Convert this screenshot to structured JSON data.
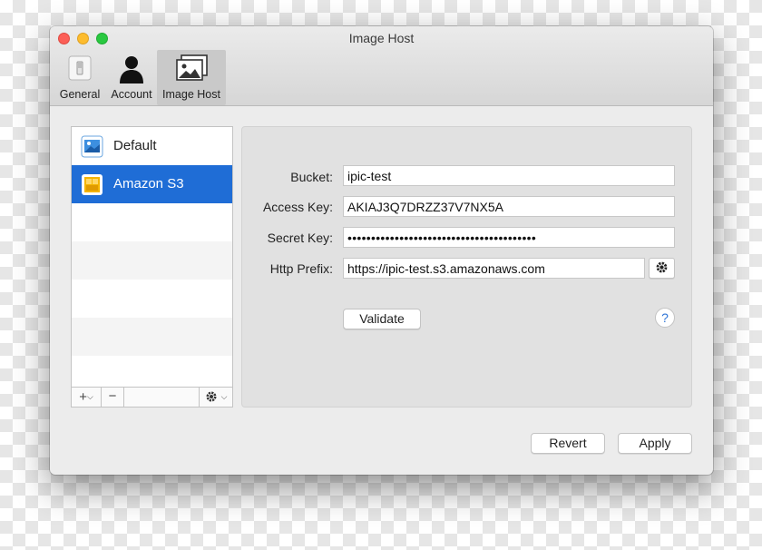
{
  "window": {
    "title": "Image Host"
  },
  "tabs": [
    {
      "label": "General",
      "icon": "switch-icon"
    },
    {
      "label": "Account",
      "icon": "user-silhouette-icon"
    },
    {
      "label": "Image Host",
      "icon": "photo-stack-icon",
      "active": true
    }
  ],
  "host_list": {
    "items": [
      {
        "label": "Default",
        "icon": "picture-icon"
      },
      {
        "label": "Amazon S3",
        "icon": "amazon-s3-icon",
        "selected": true
      }
    ],
    "toolbar": {
      "add": "+",
      "remove": "−"
    }
  },
  "form": {
    "bucket_label": "Bucket:",
    "bucket_value": "ipic-test",
    "access_key_label": "Access Key:",
    "access_key_value": "AKIAJ3Q7DRZZ37V7NX5A",
    "secret_key_label": "Secret Key:",
    "secret_key_value": "••••••••••••••••••••••••••••••••••••••••",
    "http_prefix_label": "Http Prefix:",
    "http_prefix_value": "https://ipic-test.s3.amazonaws.com",
    "validate_label": "Validate",
    "help_label": "?"
  },
  "footer": {
    "revert_label": "Revert",
    "apply_label": "Apply"
  },
  "colors": {
    "selection": "#1f6dd6",
    "help": "#2d74d6"
  }
}
